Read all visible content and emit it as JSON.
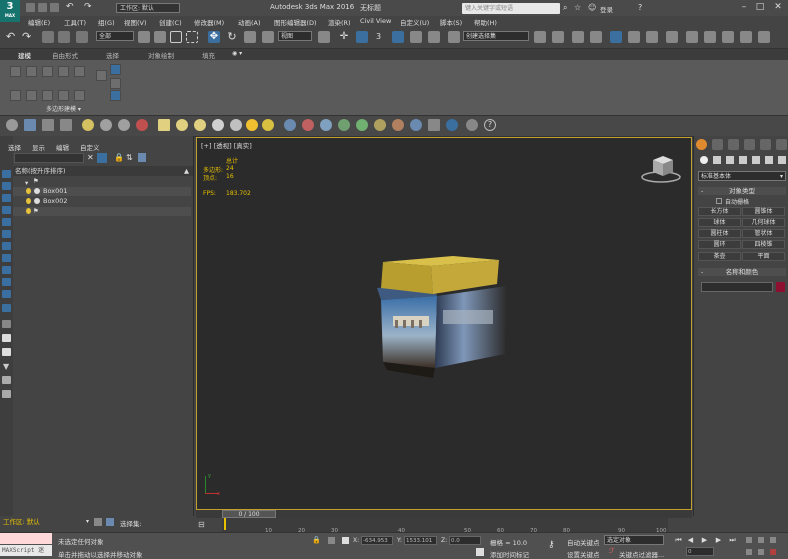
{
  "app": {
    "logo": "3",
    "logo_sub": "MAX",
    "title": "Autodesk 3ds Max 2016",
    "doc": "无标题",
    "workspace": "工作区: 默认",
    "search_placeholder": "键入关键字或短语",
    "login": "登录"
  },
  "menu": [
    "编辑(E)",
    "工具(T)",
    "组(G)",
    "视图(V)",
    "创建(C)",
    "修改器(M)",
    "动画(A)",
    "图形编辑器(D)",
    "渲染(R)",
    "Civil View",
    "自定义(U)",
    "脚本(S)",
    "帮助(H)"
  ],
  "toolbar": {
    "selection_filter": "全部",
    "ref_coord": "视图",
    "named_sel": "创建选择集",
    "number_3": "3"
  },
  "ribbon": {
    "tabs": [
      "建模",
      "自由形式",
      "选择",
      "对象绘制",
      "填充"
    ],
    "label": "多边形建模"
  },
  "explorer": {
    "tabs": [
      "选择",
      "显示",
      "编辑",
      "自定义"
    ],
    "header": "名称(按升序排序)",
    "rows": [
      "",
      "Box001",
      "Box002",
      ""
    ]
  },
  "viewport": {
    "label": "[+] [透视] [真实]",
    "stats": {
      "total_label": "总计",
      "polys_label": "多边形:",
      "polys": "24",
      "verts_label": "顶点:",
      "verts": "16",
      "fps_label": "FPS:",
      "fps": "183.702"
    },
    "axis": {
      "x": "x",
      "y": "y"
    }
  },
  "cmdpanel": {
    "category": "标准基本体",
    "rollout_type": "对象类型",
    "autogrid": "自动栅格",
    "buttons": [
      "长方体",
      "圆锥体",
      "球体",
      "几何球体",
      "圆柱体",
      "管状体",
      "圆环",
      "四棱锥",
      "茶壶",
      "平面"
    ],
    "rollout_name": "名称和颜色",
    "color": "#8e1030"
  },
  "timeline": {
    "frame": "0 / 100",
    "ticks": [
      "10",
      "20",
      "30",
      "40",
      "50",
      "60",
      "70",
      "80",
      "90",
      "100"
    ]
  },
  "status": {
    "workspace": "工作区: 默认",
    "selection_set": "选择集:",
    "maxscript": "MAXScript 迷",
    "line1": "未选定任何对象",
    "line2": "单击并拖动以选择并移动对象",
    "x_label": "X:",
    "x": "-634.953",
    "y_label": "Y:",
    "y": "1533.101",
    "z_label": "Z:",
    "z": "0.0",
    "grid": "栅格 = 10.0",
    "add_time_tag": "添加时间标记",
    "auto_key": "自动关键点",
    "set_key": "设置关键点",
    "key_mode": "选定对象",
    "key_filters": "关键点过滤器...",
    "frame_num": "0"
  },
  "colors": {
    "accent": "#3a6fa0",
    "viewport_border": "#c3a02e",
    "stats_yellow": "#e8c100",
    "box_top": "#c4a93a"
  }
}
